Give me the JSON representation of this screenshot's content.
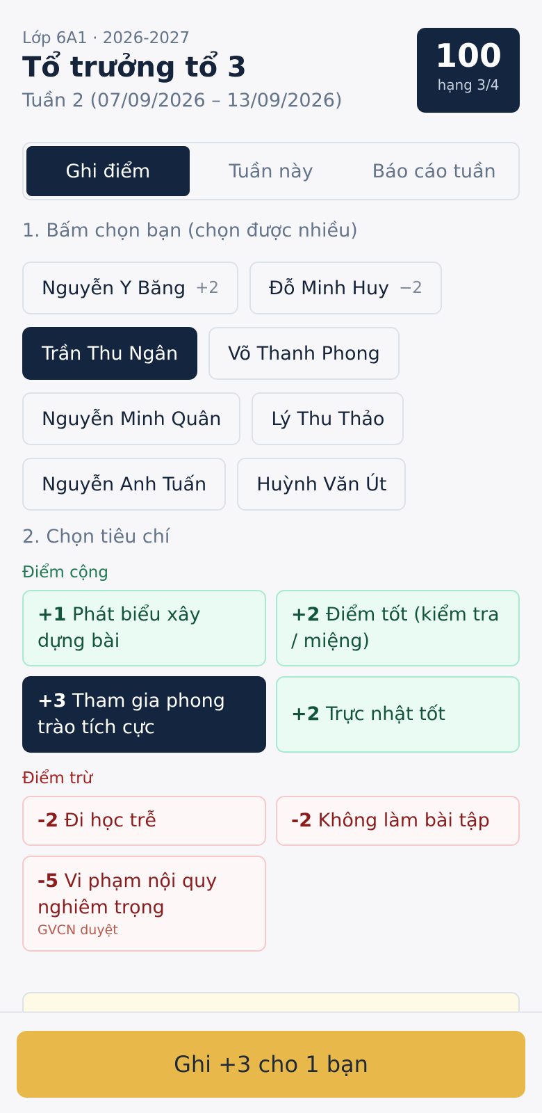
{
  "header": {
    "class_line": "Lớp 6A1 · 2026-2027",
    "title": "Tổ trưởng tổ 3",
    "week": "Tuần 2 (07/09/2026 – 13/09/2026)",
    "score": "100",
    "rank": "hạng 3/4"
  },
  "tabs": [
    {
      "label": "Ghi điểm",
      "active": true
    },
    {
      "label": "Tuần này",
      "active": false
    },
    {
      "label": "Báo cáo tuần",
      "active": false
    }
  ],
  "step1_label": "1. Bấm chọn bạn (chọn được nhiều)",
  "students": [
    {
      "name": "Nguyễn Y Băng",
      "delta": "+2",
      "selected": false
    },
    {
      "name": "Đỗ Minh Huy",
      "delta": "−2",
      "selected": false
    },
    {
      "name": "Trần Thu Ngân",
      "delta": "",
      "selected": true
    },
    {
      "name": "Võ Thanh Phong",
      "delta": "",
      "selected": false
    },
    {
      "name": "Nguyễn Minh Quân",
      "delta": "",
      "selected": false
    },
    {
      "name": "Lý Thu Thảo",
      "delta": "",
      "selected": false
    },
    {
      "name": "Nguyễn Anh Tuấn",
      "delta": "",
      "selected": false
    },
    {
      "name": "Huỳnh Văn Út",
      "delta": "",
      "selected": false
    }
  ],
  "step2_label": "2. Chọn tiêu chí",
  "plus_label": "Điểm cộng",
  "plus_criteria": [
    {
      "points": "+1",
      "text": "Phát biểu xây dựng bài",
      "selected": false
    },
    {
      "points": "+2",
      "text": "Điểm tốt (kiểm tra / miệng)",
      "selected": false
    },
    {
      "points": "+3",
      "text": "Tham gia phong trào tích cực",
      "selected": true
    },
    {
      "points": "+2",
      "text": "Trực nhật tốt",
      "selected": false
    }
  ],
  "minus_label": "Điểm trừ",
  "minus_criteria": [
    {
      "points": "-2",
      "text": "Đi học trễ",
      "note": "",
      "selected": false
    },
    {
      "points": "-2",
      "text": "Không làm bài tập",
      "note": "",
      "selected": false
    },
    {
      "points": "-5",
      "text": "Vi phạm nội quy nghiêm trọng",
      "note": "GVCN duyệt",
      "selected": false
    }
  ],
  "submit_label": "Ghi +3 cho 1 bạn"
}
